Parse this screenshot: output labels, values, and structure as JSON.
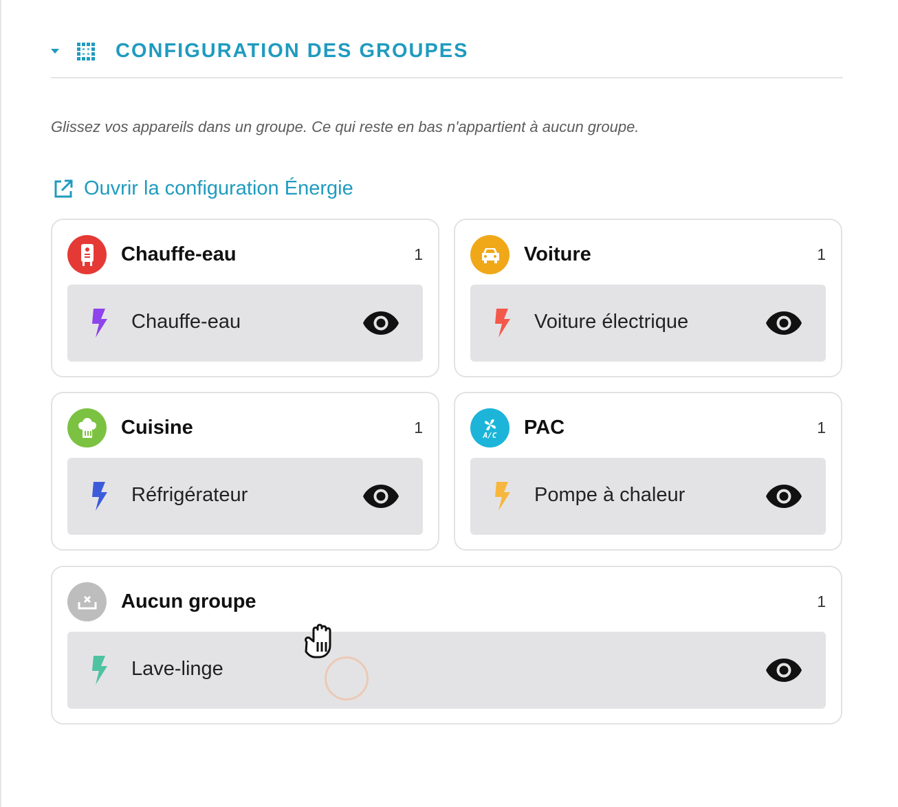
{
  "section": {
    "title": "CONFIGURATION DES GROUPES",
    "hint": "Glissez vos appareils dans un groupe. Ce qui reste en bas n'appartient à aucun groupe.",
    "link_label": "Ouvrir la configuration Énergie"
  },
  "groups": [
    {
      "name": "Chauffe-eau",
      "count": "1",
      "avatar_color": "#e53935",
      "avatar_icon": "water-heater-icon",
      "device": {
        "name": "Chauffe-eau",
        "bolt_color": "#8e44ec",
        "visibility_icon": "eye-icon"
      }
    },
    {
      "name": "Voiture",
      "count": "1",
      "avatar_color": "#f0a818",
      "avatar_icon": "car-icon",
      "device": {
        "name": "Voiture électrique",
        "bolt_color": "#f4584a",
        "visibility_icon": "eye-icon"
      }
    },
    {
      "name": "Cuisine",
      "count": "1",
      "avatar_color": "#7cc242",
      "avatar_icon": "chef-hat-icon",
      "device": {
        "name": "Réfrigérateur",
        "bolt_color": "#3b5bdb",
        "visibility_icon": "eye-icon"
      }
    },
    {
      "name": "PAC",
      "count": "1",
      "avatar_color": "#1cb5d9",
      "avatar_icon": "air-conditioner-icon",
      "avatar_text": "A/C",
      "device": {
        "name": "Pompe à chaleur",
        "bolt_color": "#f6b73c",
        "visibility_icon": "eye-icon"
      }
    },
    {
      "name": "Aucun groupe",
      "count": "1",
      "avatar_color": "#bdbdbd",
      "avatar_icon": "tray-remove-icon",
      "device": {
        "name": "Lave-linge",
        "bolt_color": "#4fc3a1",
        "visibility_icon": "eye-icon"
      }
    }
  ],
  "colors": {
    "accent": "#1f9bbf",
    "card_border": "#e2e2e2",
    "device_row_bg": "#e3e3e5"
  },
  "cursor": {
    "icon": "grab-hand-icon"
  }
}
